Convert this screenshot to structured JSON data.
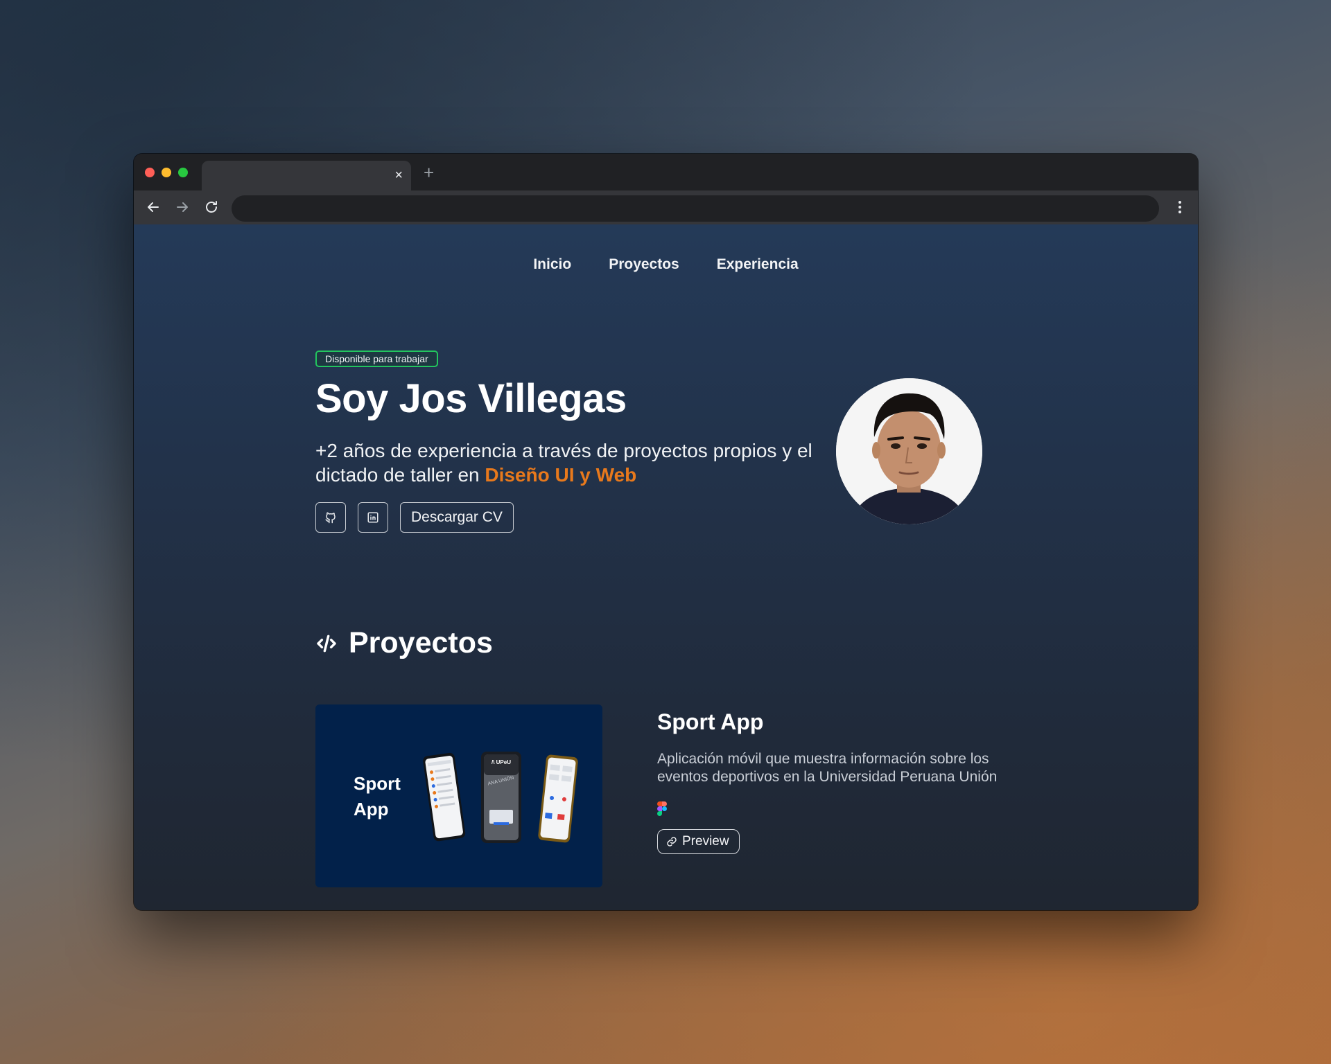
{
  "browser": {
    "tab_close": "×",
    "new_tab": "+",
    "address": ""
  },
  "nav": {
    "items": [
      {
        "label": "Inicio"
      },
      {
        "label": "Proyectos"
      },
      {
        "label": "Experiencia"
      }
    ]
  },
  "hero": {
    "badge": "Disponible para trabajar",
    "title": "Soy Jos Villegas",
    "description_start": "+2 años de experiencia a través de proyectos propios y el dictado de taller en ",
    "description_accent": "Diseño UI y Web",
    "github_icon": "github-icon",
    "linkedin_icon": "linkedin-icon",
    "cv_label": "Descargar CV"
  },
  "projects": {
    "section_title": "Proyectos",
    "section_icon": "code-icon",
    "items": [
      {
        "image_title_line1": "Sport",
        "image_title_line2": "App",
        "image_logo": "/\\ UPeU",
        "image_banner": "ANA UNIÓN",
        "title": "Sport App",
        "description": "Aplicación móvil que muestra información sobre los eventos deportivos en la Universidad Peruana Unión",
        "tech_icon": "figma-icon",
        "preview_label": "Preview"
      }
    ]
  },
  "colors": {
    "accent": "#e8791c",
    "badge_border": "#22c55e",
    "project_bg": "#02214a"
  }
}
